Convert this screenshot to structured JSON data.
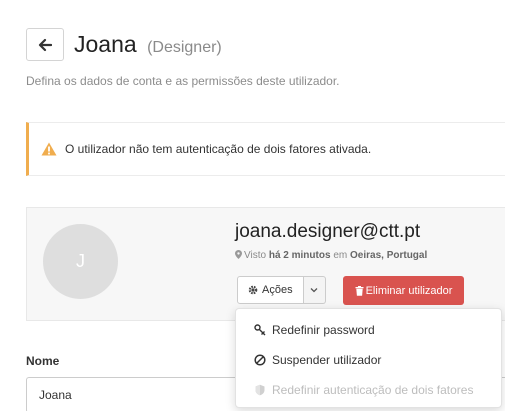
{
  "header": {
    "name": "Joana",
    "role": "(Designer)",
    "subtitle": "Defina os dados de conta e as permissões deste utilizador."
  },
  "alert": {
    "text": "O utilizador não tem autenticação de dois fatores ativada.",
    "color": "#f0ad4e"
  },
  "profile": {
    "avatar_initial": "J",
    "email": "joana.designer@ctt.pt",
    "seen_prefix": "Visto",
    "seen_time": "há 2 minutos",
    "seen_in": "em",
    "seen_location": "Oeiras, Portugal"
  },
  "actions": {
    "label": "Ações",
    "delete_label": "Eliminar utilizador",
    "delete_color": "#d9534f"
  },
  "dropdown": {
    "items": [
      {
        "label": "Redefinir password",
        "icon": "key-icon",
        "disabled": false
      },
      {
        "label": "Suspender utilizador",
        "icon": "ban-icon",
        "disabled": false
      },
      {
        "label": "Redefinir autenticação de dois fatores",
        "icon": "shield-icon",
        "disabled": true
      }
    ]
  },
  "form": {
    "name_label": "Nome",
    "name_value": "Joana"
  }
}
